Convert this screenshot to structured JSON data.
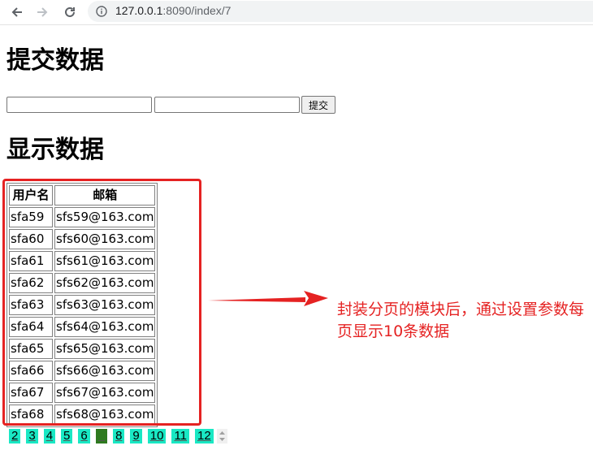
{
  "browser": {
    "url_host": "127.0.0.1",
    "url_path": ":8090/index/7"
  },
  "form": {
    "heading": "提交数据",
    "field1_value": "",
    "field2_value": "",
    "submit_label": "提交"
  },
  "display": {
    "heading": "显示数据",
    "columns": [
      "用户名",
      "邮箱"
    ],
    "rows": [
      [
        "sfa59",
        "sfs59@163.com"
      ],
      [
        "sfa60",
        "sfs60@163.com"
      ],
      [
        "sfa61",
        "sfs61@163.com"
      ],
      [
        "sfa62",
        "sfs62@163.com"
      ],
      [
        "sfa63",
        "sfs63@163.com"
      ],
      [
        "sfa64",
        "sfs64@163.com"
      ],
      [
        "sfa65",
        "sfs65@163.com"
      ],
      [
        "sfa66",
        "sfs66@163.com"
      ],
      [
        "sfa67",
        "sfs67@163.com"
      ],
      [
        "sfa68",
        "sfs68@163.com"
      ]
    ]
  },
  "annotation": {
    "text": "封装分页的模块后，通过设置参数每页显示10条数据",
    "color": "#e52222"
  },
  "pagination": {
    "pages": [
      "2",
      "3",
      "4",
      "5",
      "6",
      "7",
      "8",
      "9",
      "10",
      "11",
      "12"
    ],
    "current": "7",
    "link_color": "#19e8c4",
    "current_color": "#2e7a1f"
  }
}
